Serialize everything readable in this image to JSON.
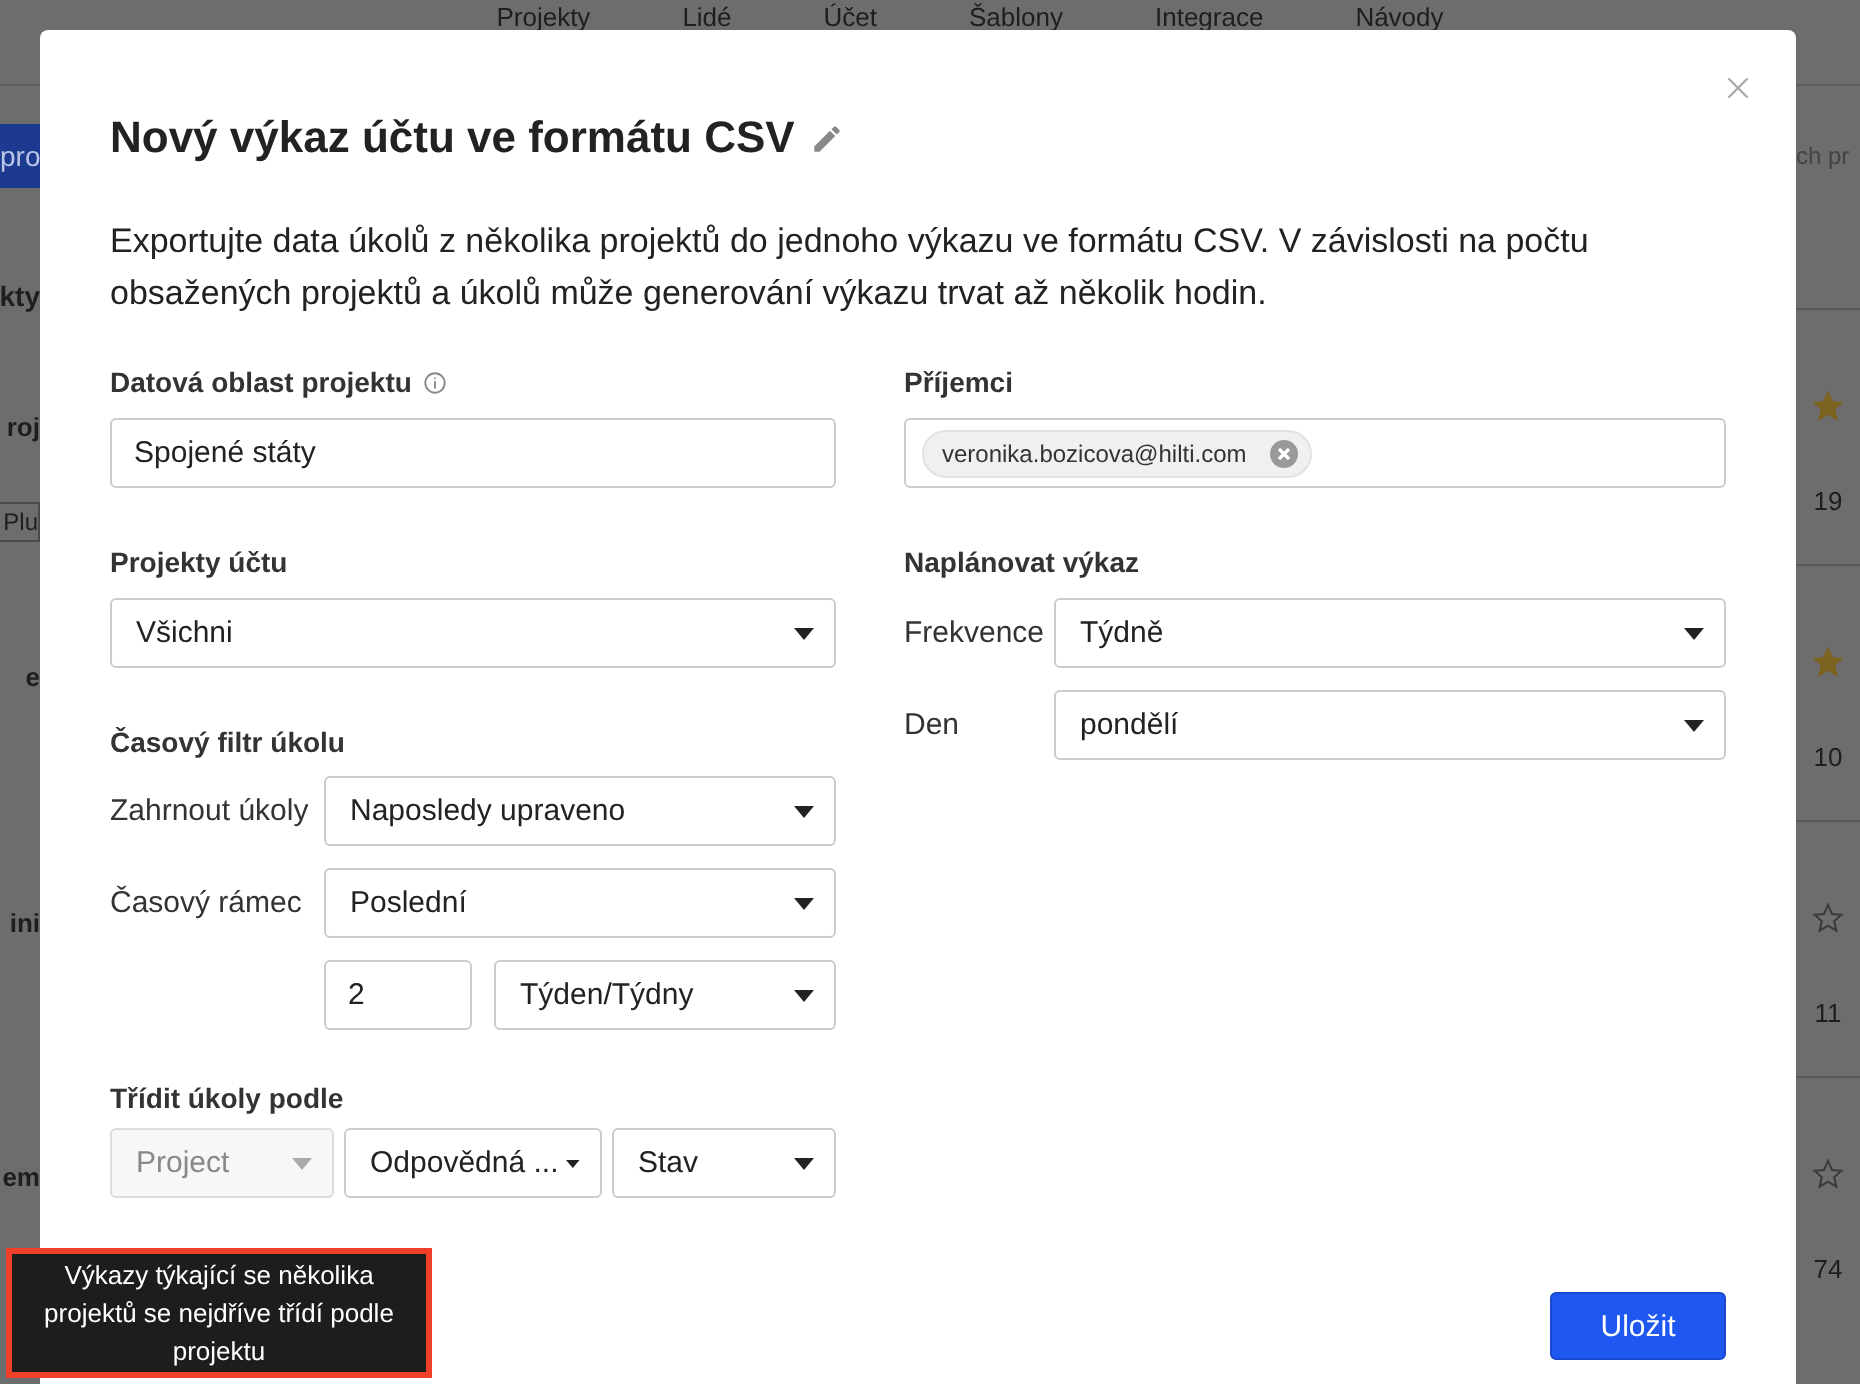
{
  "background": {
    "nav": [
      "Projekty",
      "Lidé",
      "Účet",
      "Šablony",
      "Integrace",
      "Návody"
    ],
    "left_fragments": [
      {
        "kind": "button",
        "text": "pro"
      },
      {
        "kind": "heading",
        "text": "kty"
      },
      {
        "kind": "title",
        "text": "roj"
      },
      {
        "kind": "tag",
        "text": "Plu"
      },
      {
        "kind": "title",
        "text": "e"
      },
      {
        "kind": "title",
        "text": "ini"
      },
      {
        "kind": "title",
        "text": "em"
      }
    ],
    "search": {
      "placeholder": "ch pr"
    },
    "rows": [
      {
        "starred": true,
        "count": "19"
      },
      {
        "starred": true,
        "count": "10"
      },
      {
        "starred": false,
        "count": "11"
      },
      {
        "starred": false,
        "count": "74"
      }
    ]
  },
  "dialog": {
    "title": "Nový výkaz účtu ve formátu CSV",
    "description": "Exportujte data úkolů z několika projektů do jednoho výkazu ve formátu CSV. V závislosti na počtu obsažených projektů a úkolů může generování výkazu trvat až několik hodin.",
    "project_area": {
      "label": "Datová oblast projektu",
      "value": "Spojené státy"
    },
    "account_projects": {
      "label": "Projekty účtu",
      "value": "Všichni"
    },
    "time_filter": {
      "label": "Časový filtr úkolu",
      "include": {
        "label": "Zahrnout úkoly",
        "value": "Naposledy upraveno"
      },
      "timeframe": {
        "label": "Časový rámec",
        "value": "Poslední"
      },
      "amount": {
        "value": "2"
      },
      "unit": {
        "value": "Týden/Týdny"
      }
    },
    "sort": {
      "label": "Třídit úkoly podle",
      "options": [
        {
          "value": "Project",
          "disabled": true
        },
        {
          "value": "Odpovědná ...",
          "disabled": false
        },
        {
          "value": "Stav",
          "disabled": false
        }
      ],
      "tooltip": "Výkazy týkající se několika projektů se nejdříve třídí podle projektu"
    },
    "recipients": {
      "label": "Příjemci",
      "chips": [
        "veronika.bozicova@hilti.com"
      ]
    },
    "schedule": {
      "label": "Naplánovat výkaz",
      "frequency": {
        "label": "Frekvence",
        "value": "Týdně"
      },
      "day": {
        "label": "Den",
        "value": "pondělí"
      }
    },
    "save_button": "Uložit"
  }
}
